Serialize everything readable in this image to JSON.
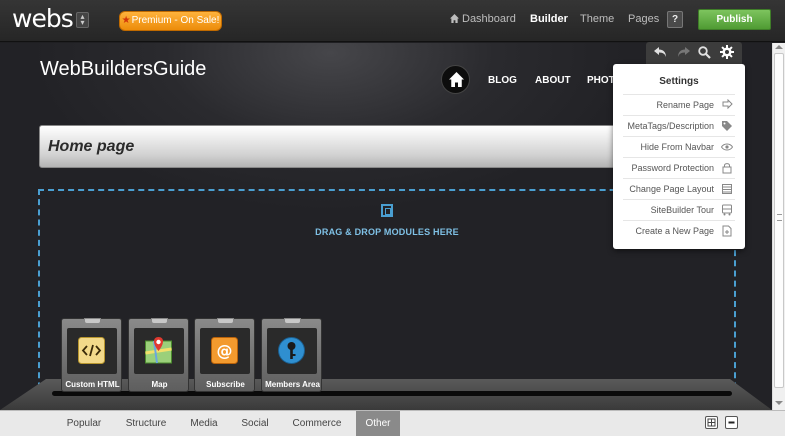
{
  "topbar": {
    "logo": "webs",
    "premium_label": "Premium - On Sale!",
    "nav": {
      "dashboard": "Dashboard",
      "builder": "Builder",
      "theme": "Theme",
      "pages": "Pages"
    },
    "help": "?",
    "publish": "Publish"
  },
  "site": {
    "title": "WebBuildersGuide",
    "nav": [
      "BLOG",
      "ABOUT",
      "PHOT"
    ],
    "page_header": "Home page",
    "drop_zone_text": "DRAG & DROP MODULES HERE"
  },
  "settings_menu": {
    "title": "Settings",
    "items": [
      {
        "label": "Rename Page",
        "icon": "rename-icon"
      },
      {
        "label": "MetaTags/Description",
        "icon": "tag-icon"
      },
      {
        "label": "Hide From Navbar",
        "icon": "eye-icon"
      },
      {
        "label": "Password Protection",
        "icon": "lock-icon"
      },
      {
        "label": "Change Page Layout",
        "icon": "layout-icon"
      },
      {
        "label": "SiteBuilder Tour",
        "icon": "bus-icon"
      },
      {
        "label": "Create a New Page",
        "icon": "new-page-icon"
      }
    ]
  },
  "modules": [
    {
      "label": "Custom HTML",
      "icon": "code-icon",
      "color": "#e8c76a"
    },
    {
      "label": "Map",
      "icon": "map-icon",
      "color": "#6fbf5a"
    },
    {
      "label": "Subscribe",
      "icon": "at-icon",
      "color": "#f08a24"
    },
    {
      "label": "Members Area",
      "icon": "key-icon",
      "color": "#2f8fd0"
    }
  ],
  "bottom_tabs": [
    "Popular",
    "Structure",
    "Media",
    "Social",
    "Commerce",
    "Other"
  ],
  "active_tab": "Other",
  "colors": {
    "publish": "#5aa83c",
    "premium": "#f5a020",
    "drop_zone_border": "#4a9fd1"
  }
}
